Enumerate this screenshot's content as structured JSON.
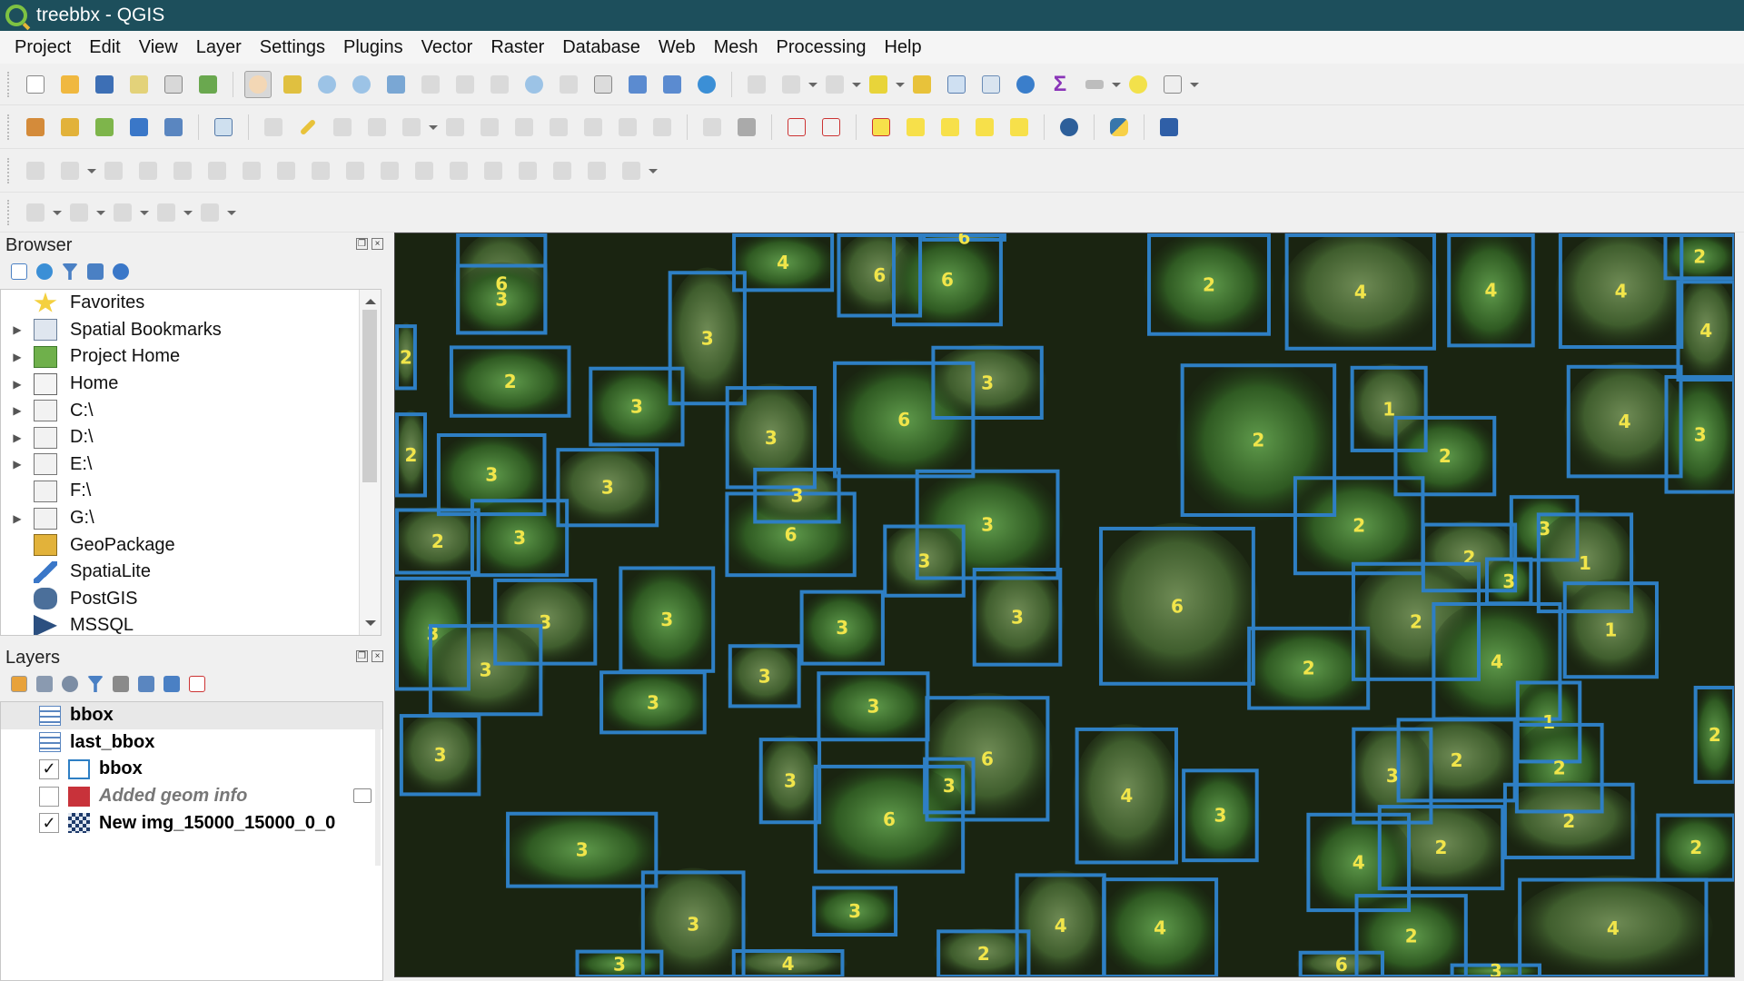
{
  "window": {
    "title": "treebbx - QGIS"
  },
  "menu": [
    "Project",
    "Edit",
    "View",
    "Layer",
    "Settings",
    "Plugins",
    "Vector",
    "Raster",
    "Database",
    "Web",
    "Mesh",
    "Processing",
    "Help"
  ],
  "browser": {
    "title": "Browser",
    "items": [
      {
        "label": "Favorites",
        "icon": "star-icon",
        "expandable": false
      },
      {
        "label": "Spatial Bookmarks",
        "icon": "bookmark-icon",
        "expandable": true
      },
      {
        "label": "Project Home",
        "icon": "project-home-icon",
        "expandable": true
      },
      {
        "label": "Home",
        "icon": "home-folder-icon",
        "expandable": true
      },
      {
        "label": "C:\\",
        "icon": "folder-icon",
        "expandable": true
      },
      {
        "label": "D:\\",
        "icon": "folder-icon",
        "expandable": true
      },
      {
        "label": "E:\\",
        "icon": "folder-icon",
        "expandable": true
      },
      {
        "label": "F:\\",
        "icon": "folder-icon",
        "expandable": false
      },
      {
        "label": "G:\\",
        "icon": "folder-icon",
        "expandable": true
      },
      {
        "label": "GeoPackage",
        "icon": "geopackage-icon",
        "expandable": false
      },
      {
        "label": "SpatiaLite",
        "icon": "spatialite-icon",
        "expandable": false
      },
      {
        "label": "PostGIS",
        "icon": "postgis-icon",
        "expandable": false
      },
      {
        "label": "MSSQL",
        "icon": "mssql-icon",
        "expandable": false
      }
    ]
  },
  "layers": {
    "title": "Layers",
    "items": [
      {
        "label": "bbox",
        "kind": "table",
        "checked": null,
        "selected": true
      },
      {
        "label": "last_bbox",
        "kind": "table",
        "checked": null,
        "selected": false
      },
      {
        "label": "bbox",
        "kind": "polygon",
        "checked": true,
        "selected": false
      },
      {
        "label": "Added geom info",
        "kind": "polygon-red",
        "checked": false,
        "selected": false,
        "italic": true
      },
      {
        "label": "New img_15000_15000_0_0",
        "kind": "raster",
        "checked": true,
        "selected": false
      }
    ]
  },
  "map": {
    "box_color": "#2e7fc4",
    "label_color": "#f1e54a",
    "boxes": [
      [
        "6",
        0.0455,
        0.0,
        0.1134,
        0.1359
      ],
      [
        "3",
        0.0455,
        0.0409,
        0.1134,
        0.1359
      ],
      [
        "2",
        0.0,
        0.1221,
        0.0162,
        0.2103
      ],
      [
        "2",
        0.0406,
        0.1505,
        0.1311,
        0.2473
      ],
      [
        "3",
        0.2037,
        0.0503,
        0.2621,
        0.2308
      ],
      [
        "4",
        0.2514,
        0.0,
        0.3273,
        0.0785
      ],
      [
        "6",
        0.3296,
        0.0,
        0.393,
        0.1128
      ],
      [
        "6",
        0.3706,
        0.0,
        0.4532,
        0.1247
      ],
      [
        "6",
        0.393,
        0.0,
        0.4559,
        0.0109
      ],
      [
        "2",
        0.561,
        0.0,
        0.6531,
        0.1375
      ],
      [
        "4",
        0.6637,
        0.0,
        0.7764,
        0.157
      ],
      [
        "4",
        0.7847,
        0.0,
        0.8501,
        0.1529
      ],
      [
        "4",
        0.8678,
        0.0,
        0.9609,
        0.1549
      ],
      [
        "2",
        0.9461,
        0.0,
        1.0,
        0.0626
      ],
      [
        "4",
        0.9556,
        0.0626,
        1.0,
        0.1988
      ],
      [
        "3",
        0.1445,
        0.1789,
        0.2158,
        0.2859
      ],
      [
        "3",
        0.2464,
        0.205,
        0.3143,
        0.3432
      ],
      [
        "6",
        0.3266,
        0.1717,
        0.4325,
        0.3285
      ],
      [
        "3",
        0.4,
        0.1509,
        0.4836,
        0.25
      ],
      [
        "2",
        0.5858,
        0.1747,
        0.702,
        0.3805
      ],
      [
        "1",
        0.7125,
        0.1778,
        0.7701,
        0.2938
      ],
      [
        "2",
        0.7449,
        0.245,
        0.8213,
        0.3528
      ],
      [
        "4",
        0.8738,
        0.1766,
        0.9604,
        0.3285
      ],
      [
        "3",
        0.9468,
        0.1902,
        1.0,
        0.3495
      ],
      [
        "2",
        0.0,
        0.2404,
        0.0237,
        0.3542
      ],
      [
        "3",
        0.0311,
        0.2683,
        0.1128,
        0.3794
      ],
      [
        "3",
        0.1202,
        0.288,
        0.1966,
        0.3943
      ],
      [
        "6",
        0.2462,
        0.3469,
        0.344,
        0.4612
      ],
      [
        "3",
        0.2671,
        0.3145,
        0.3324,
        0.3896
      ],
      [
        "3",
        0.388,
        0.3168,
        0.4956,
        0.4652
      ],
      [
        "3",
        0.364,
        0.3909,
        0.4253,
        0.4887
      ],
      [
        "2",
        0.67,
        0.3259,
        0.7679,
        0.4588
      ],
      [
        "2",
        0.7655,
        0.3885,
        0.8368,
        0.482
      ],
      [
        "3",
        0.8312,
        0.3514,
        0.8831,
        0.4408
      ],
      [
        "1",
        0.8515,
        0.3749,
        0.9235,
        0.5099
      ],
      [
        "3",
        0.813,
        0.4348,
        0.8485,
        0.4991
      ],
      [
        "6",
        0.5251,
        0.3938,
        0.6415,
        0.607
      ],
      [
        "2",
        0.6356,
        0.5278,
        0.7271,
        0.6397
      ],
      [
        "2",
        0.7134,
        0.4412,
        0.8096,
        0.601
      ],
      [
        "4",
        0.7733,
        0.4951,
        0.8702,
        0.6544
      ],
      [
        "1",
        0.8711,
        0.4673,
        0.9424,
        0.5978
      ],
      [
        "3",
        0.0,
        0.4607,
        0.0562,
        0.614
      ],
      [
        "2",
        0.0,
        0.3689,
        0.0635,
        0.4579
      ],
      [
        "3",
        0.0562,
        0.3564,
        0.1295,
        0.4612
      ],
      [
        "3",
        0.0733,
        0.4633,
        0.1506,
        0.58
      ],
      [
        "3",
        0.1669,
        0.4469,
        0.2386,
        0.59
      ],
      [
        "3",
        0.025,
        0.5245,
        0.11,
        0.6479
      ],
      [
        "3",
        0.1525,
        0.5869,
        0.2322,
        0.6724
      ],
      [
        "3",
        0.2485,
        0.5515,
        0.3026,
        0.6371
      ],
      [
        "3",
        0.3019,
        0.4788,
        0.3651,
        0.58
      ],
      [
        "3",
        0.4307,
        0.4488,
        0.4975,
        0.5813
      ],
      [
        "3",
        0.3146,
        0.5881,
        0.3987,
        0.682
      ],
      [
        "6",
        0.3953,
        0.621,
        0.4881,
        0.7896
      ],
      [
        "3",
        0.3937,
        0.7032,
        0.4326,
        0.7797
      ],
      [
        "3",
        0.2715,
        0.677,
        0.3178,
        0.793
      ],
      [
        "6",
        0.3122,
        0.7133,
        0.4249,
        0.8593
      ],
      [
        "4",
        0.5072,
        0.6633,
        0.584,
        0.8469
      ],
      [
        "3",
        0.5868,
        0.7187,
        0.6441,
        0.8441
      ],
      [
        "3",
        0.0033,
        0.6452,
        0.0639,
        0.7554
      ],
      [
        "1",
        0.8359,
        0.6006,
        0.885,
        0.7115
      ],
      [
        "2",
        0.747,
        0.6504,
        0.8365,
        0.7639
      ],
      [
        "2",
        0.8353,
        0.6572,
        0.9015,
        0.7786
      ],
      [
        "3",
        0.7136,
        0.6631,
        0.774,
        0.7934
      ],
      [
        "2",
        0.9686,
        0.6073,
        1.0,
        0.7388
      ],
      [
        "2",
        0.8265,
        0.7375,
        0.9245,
        0.8403
      ],
      [
        "2",
        0.9406,
        0.7787,
        1.0,
        0.8703
      ],
      [
        "2",
        0.7329,
        0.7672,
        0.8274,
        0.8819
      ],
      [
        "4",
        0.6798,
        0.7778,
        0.7575,
        0.9111
      ],
      [
        "4",
        0.8375,
        0.8653,
        0.9793,
        1.0
      ],
      [
        "3",
        0.0827,
        0.7765,
        0.196,
        0.8788
      ],
      [
        "3",
        0.1835,
        0.8554,
        0.2612,
        1.0
      ],
      [
        "3",
        0.3111,
        0.8762,
        0.3747,
        0.9439
      ],
      [
        "4",
        0.4625,
        0.859,
        0.5303,
        1.0
      ],
      [
        "4",
        0.5272,
        0.8648,
        0.6139,
        1.0
      ],
      [
        "2",
        0.4039,
        0.9346,
        0.4739,
        1.0
      ],
      [
        "2",
        0.7158,
        0.8867,
        0.8,
        1.0
      ],
      [
        "6",
        0.6739,
        0.9631,
        0.7378,
        1.0
      ],
      [
        "3",
        0.1345,
        0.9617,
        0.2001,
        1.0
      ],
      [
        "4",
        0.2512,
        0.961,
        0.335,
        1.0
      ],
      [
        "3",
        0.787,
        0.98,
        0.855,
        1.0
      ]
    ]
  }
}
